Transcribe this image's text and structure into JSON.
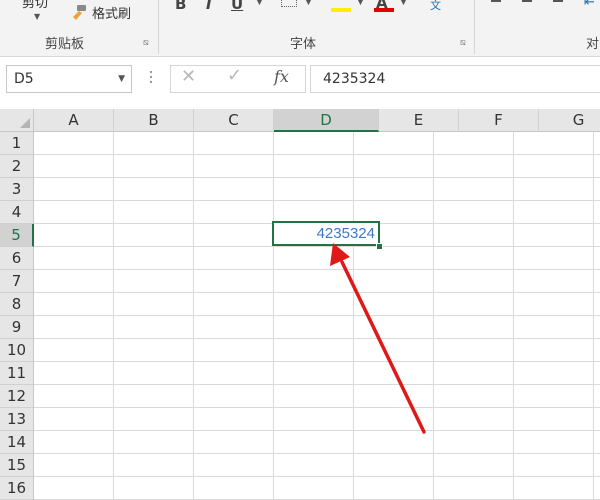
{
  "ribbon": {
    "cut_label": "剪切",
    "format_painter_label": "格式刷",
    "clipboard_group": "剪贴板",
    "font_group": "字体",
    "alignment_group": "对",
    "bold": "B",
    "italic": "I",
    "underline": "U",
    "font_color_letter": "A",
    "phonetic": "文",
    "launcher": "⧅",
    "highlight_color": "#ffef00",
    "font_color": "#e00000"
  },
  "formula_bar": {
    "name_box": "D5",
    "cancel": "✕",
    "enter": "✓",
    "fx": "fx",
    "formula": "4235324"
  },
  "sheet": {
    "columns": [
      "A",
      "B",
      "C",
      "D",
      "E",
      "F",
      "G"
    ],
    "rows": [
      "1",
      "2",
      "3",
      "4",
      "5",
      "6",
      "7",
      "8",
      "9",
      "10",
      "11",
      "12",
      "13",
      "14",
      "15",
      "16"
    ],
    "active_cell": "D5",
    "active_value": "4235324",
    "selection_color": "#217346",
    "value_color": "#3c78c0",
    "annotation_color": "#e01818"
  }
}
